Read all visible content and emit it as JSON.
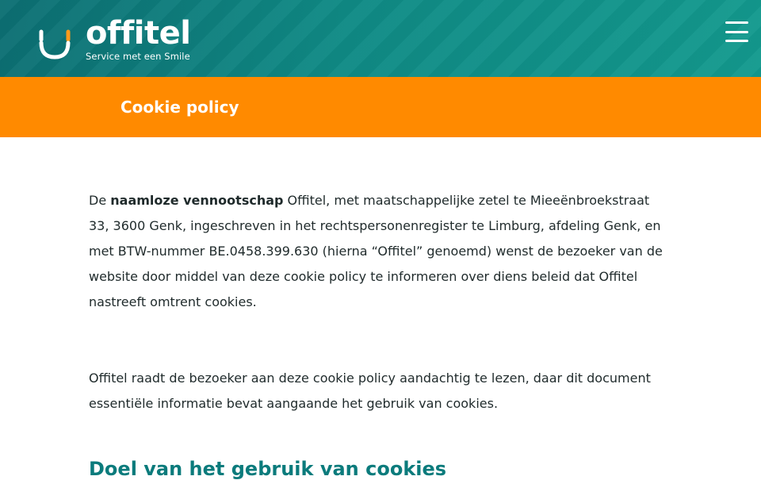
{
  "header": {
    "logo": {
      "word": "offitel",
      "tagline": "Service met een Smile"
    },
    "menu_icon": "hamburger-menu-icon"
  },
  "title_bar": {
    "title": "Cookie policy"
  },
  "content": {
    "para1": {
      "prefix": "De ",
      "bold": "naamloze vennootschap",
      "rest": " Offitel, met maatschappelijke zetel te Mieeënbroekstraat 33, 3600 Genk, ingeschreven in het rechtspersonenregister te Limburg, afdeling Genk, en met BTW-nummer BE.0458.399.630 (hierna “Offitel” genoemd) wenst de bezoeker van de website door middel van deze cookie policy te informeren over diens beleid dat Offitel nastreeft omtrent cookies."
    },
    "para2": "Offitel raadt de bezoeker aan deze cookie policy aandachtig te lezen, daar dit document essentiële informatie bevat aangaande het gebruik van cookies.",
    "section_heading": "Doel van het gebruik van cookies"
  },
  "colors": {
    "header_teal": "#0f8a85",
    "title_bar_orange": "#ff8a00",
    "heading_teal": "#0b7b7c",
    "smile_accent": "#ff9a1a"
  }
}
